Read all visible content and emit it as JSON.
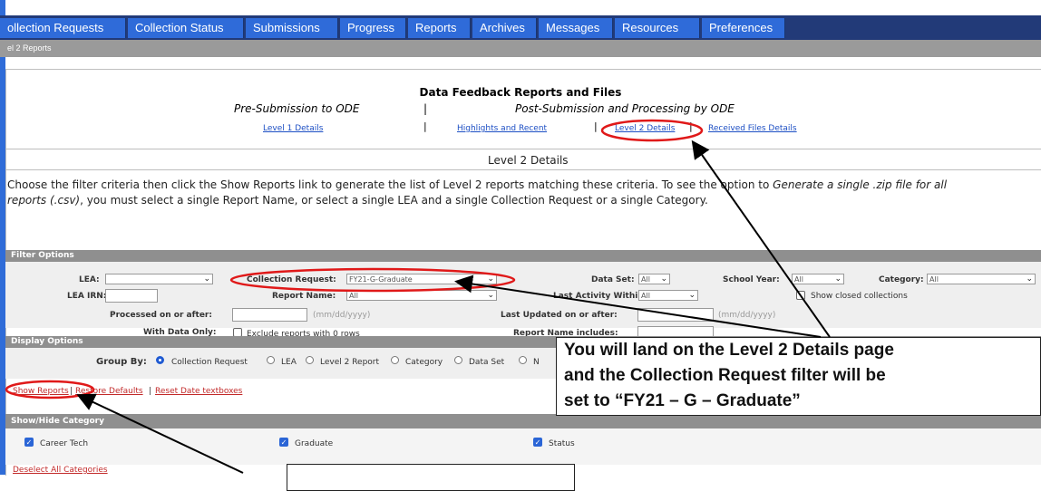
{
  "tabs": [
    "ollection Requests",
    "Collection Status",
    "Submissions",
    "Progress",
    "Reports",
    "Archives",
    "Messages",
    "Resources",
    "Preferences"
  ],
  "breadcrumb": "el 2 Reports",
  "feedback": {
    "title": "Data Feedback Reports and Files",
    "pre_title": "Pre-Submission to ODE",
    "post_title": "Post-Submission and Processing by ODE",
    "sep": "|",
    "links": {
      "level1": "Level 1 Details",
      "highlights": "Highlights and Recent",
      "level2": "Level 2 Details",
      "received": "Received Files Details"
    }
  },
  "level2_heading": "Level 2 Details",
  "intro": {
    "line1_a": "Choose the filter criteria then click the Show Reports link to generate the list of Level 2 reports matching these criteria. To see the option to ",
    "line1_em": "Generate a single .zip file for all",
    "line2_em": "reports (.csv)",
    "line2_b": ", you must select a single Report Name, or select a single LEA and a single Collection Request or a single Category."
  },
  "filter": {
    "head": "Filter Options",
    "lea_label": "LEA:",
    "lea_irn_label": "LEA IRN:",
    "collection_request_label": "Collection Request:",
    "collection_request_value": "FY21-G-Graduate",
    "report_name_label": "Report Name:",
    "report_name_value": "All",
    "data_set_label": "Data Set:",
    "data_set_value": "All",
    "school_year_label": "School Year:",
    "school_year_value": "All",
    "category_label": "Category:",
    "category_value": "All",
    "last_activity_label": "Last Activity Within:",
    "last_activity_value": "All",
    "show_closed": "Show closed collections",
    "processed_label": "Processed on or after:",
    "date_hint": "(mm/dd/yyyy)",
    "last_updated_label": "Last Updated on or after:",
    "with_data_label": "With Data Only:",
    "exclude_rows": "Exclude reports with 0 rows",
    "report_name_includes_label": "Report Name includes:"
  },
  "display": {
    "head": "Display Options",
    "group_by_label": "Group By:",
    "options": [
      "Collection Request",
      "LEA",
      "Level 2 Report",
      "Category",
      "Data Set",
      "N"
    ]
  },
  "actions": {
    "show_reports": "Show Reports",
    "restore": "Restore Defaults",
    "sep": "|",
    "reset": "Reset Date textboxes"
  },
  "categories": {
    "head": "Show/Hide Category",
    "items": [
      "Career Tech",
      "Graduate",
      "Status"
    ],
    "deselect": "Deselect All Categories"
  },
  "callout": {
    "line1": "You will land on the Level 2 Details page",
    "line2": "and the Collection Request filter will be",
    "line3": "set to “FY21 – G – Graduate”"
  },
  "colors": {
    "tab_bg": "#2f6bd9",
    "tab_bar": "#223a78",
    "highlight_ring": "#e01919"
  }
}
